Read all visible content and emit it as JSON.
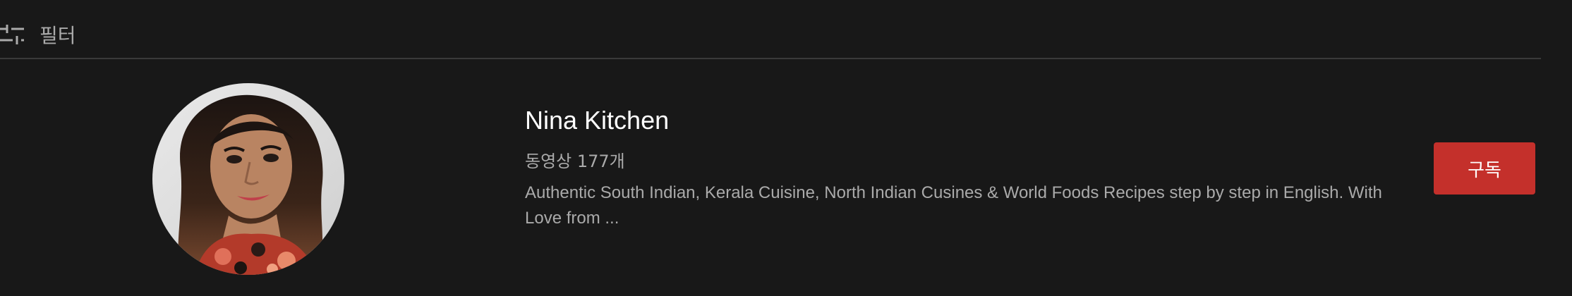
{
  "filter": {
    "icon": "sliders-icon",
    "label": "필터"
  },
  "channel": {
    "name": "Nina Kitchen",
    "video_count": "동영상 177개",
    "description": "Authentic South Indian, Kerala Cuisine, North Indian Cusines & World Foods Recipes step by step in English. With Love from ...",
    "avatar_icon": "channel-avatar"
  },
  "subscribe": {
    "label": "구독",
    "color": "#c4302b"
  },
  "colors": {
    "background": "#181818",
    "divider": "#3a3a3a",
    "primary_text": "#ffffff",
    "secondary_text": "#aaaaaa"
  }
}
